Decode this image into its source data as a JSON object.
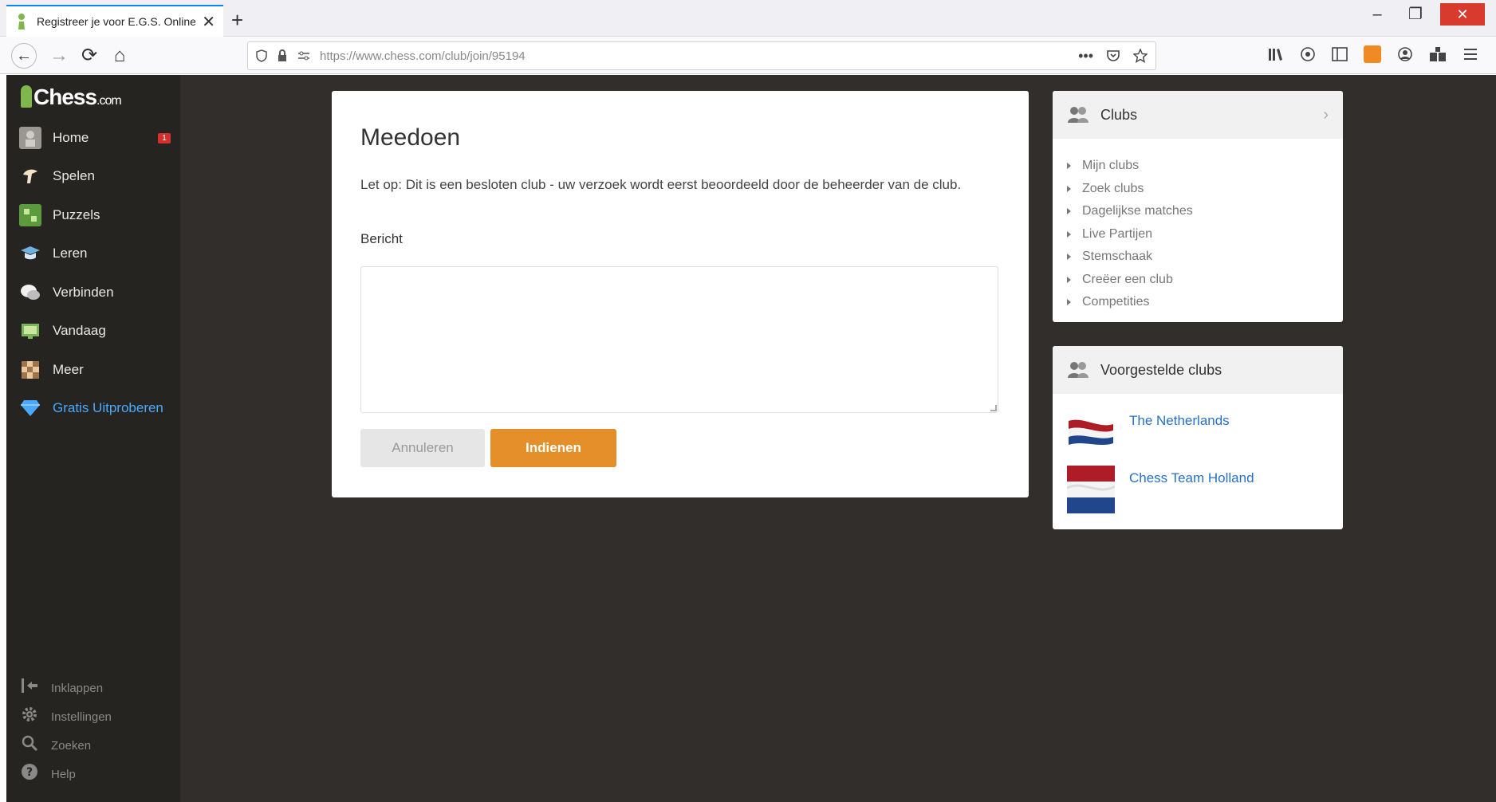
{
  "browser": {
    "tab_title": "Registreer je voor E.G.S. Online",
    "new_tab": "+",
    "url": "https://www.chess.com/club/join/95194",
    "url_dots": "•••",
    "back": "←",
    "forward": "→",
    "reload": "⟳",
    "home": "⌂",
    "close_tab": "✕",
    "minimize": "–",
    "restore": "❐",
    "close_window": "✕"
  },
  "sidebar": {
    "logo_main": "Chess",
    "logo_suffix": ".com",
    "home_badge": "1",
    "items": [
      {
        "label": "Home",
        "icon": "avatar-icon"
      },
      {
        "label": "Spelen",
        "icon": "play-icon"
      },
      {
        "label": "Puzzels",
        "icon": "puzzle-icon"
      },
      {
        "label": "Leren",
        "icon": "learn-icon"
      },
      {
        "label": "Verbinden",
        "icon": "chat-icon"
      },
      {
        "label": "Vandaag",
        "icon": "news-icon"
      },
      {
        "label": "Meer",
        "icon": "more-icon"
      },
      {
        "label": "Gratis Uitproberen",
        "icon": "diamond-icon"
      }
    ],
    "bottom": [
      {
        "label": "Inklappen",
        "icon": "collapse-icon"
      },
      {
        "label": "Instellingen",
        "icon": "settings-icon"
      },
      {
        "label": "Zoeken",
        "icon": "search-icon"
      },
      {
        "label": "Help",
        "icon": "help-icon"
      }
    ]
  },
  "join_form": {
    "title": "Meedoen",
    "note": "Let op: Dit is een besloten club - uw verzoek wordt eerst beoordeeld door de beheerder van de club.",
    "message_label": "Bericht",
    "message_value": "",
    "cancel_label": "Annuleren",
    "submit_label": "Indienen"
  },
  "clubs_panel": {
    "title": "Clubs",
    "links": [
      "Mijn clubs",
      "Zoek clubs",
      "Dagelijkse matches",
      "Live Partijen",
      "Stemschaak",
      "Creëer een club",
      "Competities"
    ]
  },
  "suggested_panel": {
    "title": "Voorgestelde clubs",
    "clubs": [
      {
        "name": "The Netherlands"
      },
      {
        "name": "Chess Team Holland"
      }
    ]
  },
  "colors": {
    "page_bg": "#312e2b",
    "sidebar_bg": "#262421",
    "submit": "#e58f2a",
    "link": "#2770c9",
    "accent": "#4aa8ff",
    "flag_red": "#ae1c28",
    "flag_blue": "#21468b"
  }
}
